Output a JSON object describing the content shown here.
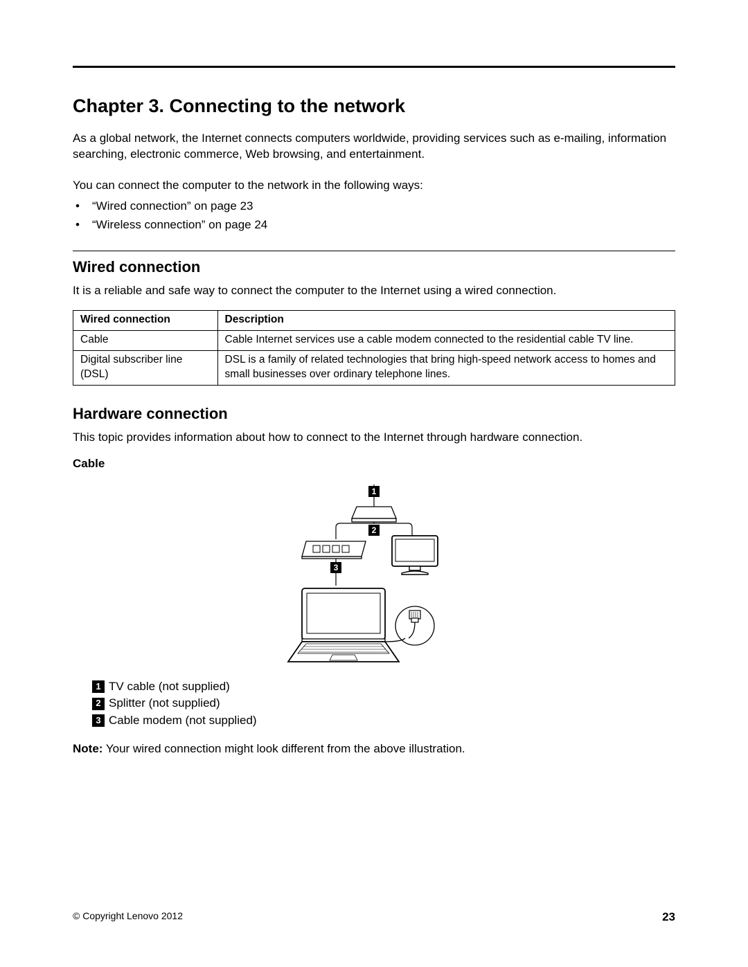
{
  "chapter_title": "Chapter 3.   Connecting to the network",
  "intro": "As a global network, the Internet connects computers worldwide, providing services such as e-mailing, information searching, electronic commerce, Web browsing, and entertainment.",
  "ways_intro": "You can connect the computer to the network in the following ways:",
  "ways": [
    "“Wired connection” on page 23",
    "“Wireless connection” on page 24"
  ],
  "section_wired": {
    "title": "Wired connection",
    "body": "It is a reliable and safe way to connect the computer to the Internet using a wired connection.",
    "table": {
      "headers": [
        "Wired connection",
        "Description"
      ],
      "rows": [
        [
          "Cable",
          "Cable Internet services use a cable modem connected to the residential cable TV line."
        ],
        [
          "Digital subscriber line (DSL)",
          "DSL is a family of related technologies that bring high-speed network access to homes and small businesses over ordinary telephone lines."
        ]
      ]
    }
  },
  "section_hw": {
    "title": "Hardware connection",
    "body": "This topic provides information about how to connect to the Internet through hardware connection.",
    "sub_title": "Cable",
    "diagram_labels": [
      "1",
      "2",
      "3"
    ],
    "legend": [
      {
        "n": "1",
        "text": "TV cable (not supplied)"
      },
      {
        "n": "2",
        "text": "Splitter (not supplied)"
      },
      {
        "n": "3",
        "text": "Cable modem (not supplied)"
      }
    ],
    "note_label": "Note:",
    "note_text": " Your wired connection might look different from the above illustration."
  },
  "footer": {
    "copyright": "© Copyright Lenovo 2012",
    "page": "23"
  }
}
